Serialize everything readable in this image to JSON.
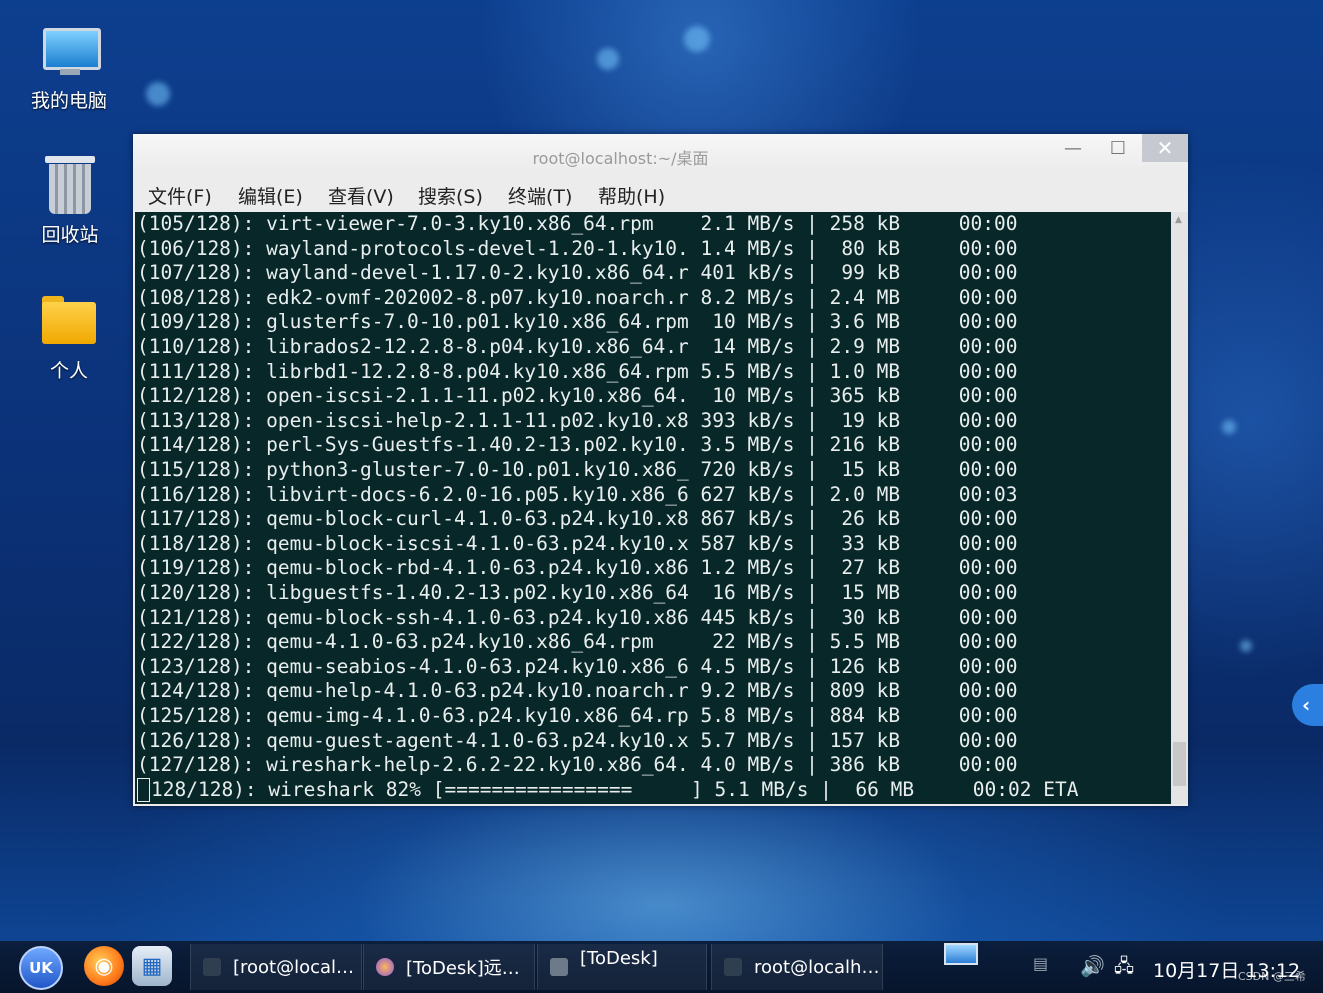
{
  "desktop": {
    "icons": [
      {
        "label": "我的电脑",
        "icon": "computer-icon"
      },
      {
        "label": "回收站",
        "icon": "trash-icon"
      },
      {
        "label": "个人",
        "icon": "folder-icon"
      }
    ]
  },
  "window": {
    "title": "root@localhost:~/桌面",
    "controls": {
      "minimize": "—",
      "maximize": "☐",
      "close": "✕"
    },
    "menu": [
      "文件(F)",
      "编辑(E)",
      "查看(V)",
      "搜索(S)",
      "终端(T)",
      "帮助(H)"
    ]
  },
  "terminal": {
    "lines": [
      "(105/128): virt-viewer-7.0-3.ky10.x86_64.rpm    2.1 MB/s | 258 kB     00:00",
      "(106/128): wayland-protocols-devel-1.20-1.ky10. 1.4 MB/s |  80 kB     00:00",
      "(107/128): wayland-devel-1.17.0-2.ky10.x86_64.r 401 kB/s |  99 kB     00:00",
      "(108/128): edk2-ovmf-202002-8.p07.ky10.noarch.r 8.2 MB/s | 2.4 MB     00:00",
      "(109/128): glusterfs-7.0-10.p01.ky10.x86_64.rpm  10 MB/s | 3.6 MB     00:00",
      "(110/128): librados2-12.2.8-8.p04.ky10.x86_64.r  14 MB/s | 2.9 MB     00:00",
      "(111/128): librbd1-12.2.8-8.p04.ky10.x86_64.rpm 5.5 MB/s | 1.0 MB     00:00",
      "(112/128): open-iscsi-2.1.1-11.p02.ky10.x86_64.  10 MB/s | 365 kB     00:00",
      "(113/128): open-iscsi-help-2.1.1-11.p02.ky10.x8 393 kB/s |  19 kB     00:00",
      "(114/128): perl-Sys-Guestfs-1.40.2-13.p02.ky10. 3.5 MB/s | 216 kB     00:00",
      "(115/128): python3-gluster-7.0-10.p01.ky10.x86_ 720 kB/s |  15 kB     00:00",
      "(116/128): libvirt-docs-6.2.0-16.p05.ky10.x86_6 627 kB/s | 2.0 MB     00:03",
      "(117/128): qemu-block-curl-4.1.0-63.p24.ky10.x8 867 kB/s |  26 kB     00:00",
      "(118/128): qemu-block-iscsi-4.1.0-63.p24.ky10.x 587 kB/s |  33 kB     00:00",
      "(119/128): qemu-block-rbd-4.1.0-63.p24.ky10.x86 1.2 MB/s |  27 kB     00:00",
      "(120/128): libguestfs-1.40.2-13.p02.ky10.x86_64  16 MB/s |  15 MB     00:00",
      "(121/128): qemu-block-ssh-4.1.0-63.p24.ky10.x86 445 kB/s |  30 kB     00:00",
      "(122/128): qemu-4.1.0-63.p24.ky10.x86_64.rpm     22 MB/s | 5.5 MB     00:00",
      "(123/128): qemu-seabios-4.1.0-63.p24.ky10.x86_6 4.5 MB/s | 126 kB     00:00",
      "(124/128): qemu-help-4.1.0-63.p24.ky10.noarch.r 9.2 MB/s | 809 kB     00:00",
      "(125/128): qemu-img-4.1.0-63.p24.ky10.x86_64.rp 5.8 MB/s | 884 kB     00:00",
      "(126/128): qemu-guest-agent-4.1.0-63.p24.ky10.x 5.7 MB/s | 157 kB     00:00",
      "(127/128): wireshark-help-2.6.2-22.ky10.x86_64. 4.0 MB/s | 386 kB     00:00"
    ],
    "last_line": "128/128): wireshark 82% [================     ] 5.1 MB/s |  66 MB     00:02 ETA",
    "download_progress": 0.82
  },
  "side_handle": {
    "glyph": "‹"
  },
  "taskbar": {
    "launchers": [
      {
        "name": "start-menu",
        "glyph": "UK"
      },
      {
        "name": "firefox",
        "glyph": "◉"
      },
      {
        "name": "file-manager",
        "glyph": "▦"
      }
    ],
    "tasks": [
      "[root@local…",
      "[ToDesk]远…",
      "[ToDesk]",
      "root@localh…"
    ],
    "clock": "10月17日 13:12",
    "watermark": "CSDN @三希"
  },
  "colors": {
    "terminal_bg": "#082728",
    "terminal_fg": "#e8eeee",
    "taskbar_bg": "#0b1e3c",
    "accent": "#2b7fe0"
  }
}
